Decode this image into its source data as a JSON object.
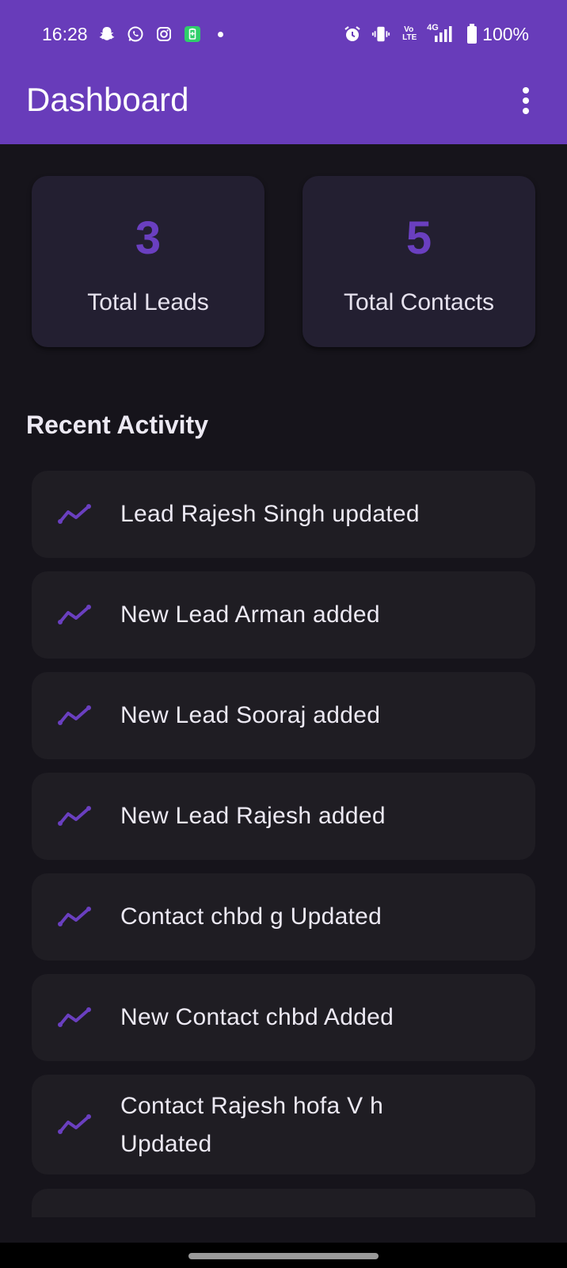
{
  "status_bar": {
    "time": "16:28",
    "left_icons": [
      "snapchat-icon",
      "whatsapp-icon",
      "instagram-icon",
      "battery-saver-icon",
      "notification-dot-icon"
    ],
    "right_icons": [
      "alarm-icon",
      "vibrate-icon",
      "volte-icon",
      "signal-4g-icon",
      "battery-icon"
    ],
    "volte_label": "Vo LTE",
    "network_label": "4G",
    "battery": "100%"
  },
  "app_bar": {
    "title": "Dashboard",
    "menu_icon": "more-vert-icon"
  },
  "stats": [
    {
      "value": "3",
      "label": "Total Leads"
    },
    {
      "value": "5",
      "label": "Total Contacts"
    }
  ],
  "recent_activity": {
    "title": "Recent Activity",
    "icon": "trending-up-icon",
    "items": [
      {
        "text": "Lead Rajesh Singh updated"
      },
      {
        "text": "New Lead Arman added"
      },
      {
        "text": "New Lead Sooraj added"
      },
      {
        "text": "New Lead Rajesh added"
      },
      {
        "text": "Contact chbd g Updated"
      },
      {
        "text": "New Contact chbd Added"
      },
      {
        "text": "Contact Rajesh hofa V h Updated"
      },
      {
        "text": ""
      }
    ]
  },
  "colors": {
    "primary": "#683cba",
    "accent": "#6a3fc0",
    "background": "#16141b",
    "stat_card": "#231f31",
    "activity_card": "#1f1d23"
  }
}
